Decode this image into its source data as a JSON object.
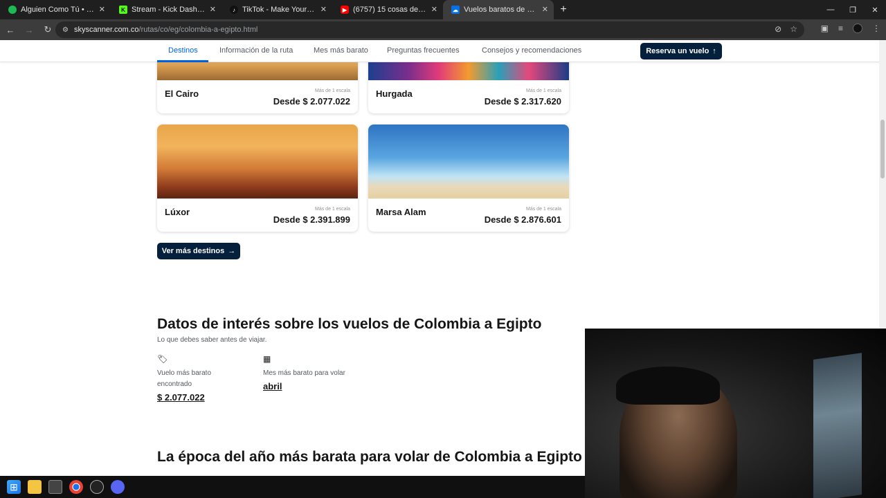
{
  "browser": {
    "tabs": [
      {
        "title": "Alguien Como Tú • Jósean Log",
        "favicon": "spotify-icon",
        "color": "#1db954",
        "active": false
      },
      {
        "title": "Stream - Kick Dashboard",
        "favicon": "kick-icon",
        "color": "#53fc18",
        "active": false
      },
      {
        "title": "TikTok - Make Your Day",
        "favicon": "tiktok-icon",
        "color": "#111111",
        "active": false
      },
      {
        "title": "(6757) 15 cosas de las pirámide",
        "favicon": "youtube-icon",
        "color": "#ff0000",
        "active": false
      },
      {
        "title": "Vuelos baratos de Colombia a E",
        "favicon": "skyscanner-icon",
        "color": "#0770e3",
        "active": true
      }
    ],
    "url_domain": "skyscanner.com.co",
    "url_path": "/rutas/co/eg/colombia-a-egipto.html"
  },
  "subnav": {
    "items": [
      "Destinos",
      "Información de la ruta",
      "Mes más barato",
      "Preguntas frecuentes",
      "Consejos y recomendaciones"
    ],
    "reserve_label": "Reserva un vuelo"
  },
  "destinations": [
    {
      "city": "El Cairo",
      "stops": "Más de 1 escala",
      "price": "Desde $ 2.077.022"
    },
    {
      "city": "Hurgada",
      "stops": "Más de 1 escala",
      "price": "Desde $ 2.317.620"
    },
    {
      "city": "Lúxor",
      "stops": "Más de 1 escala",
      "price": "Desde $ 2.391.899"
    },
    {
      "city": "Marsa Alam",
      "stops": "Más de 1 escala",
      "price": "Desde $ 2.876.601"
    }
  ],
  "more_destinations_label": "Ver más destinos",
  "facts": {
    "title": "Datos de interés sobre los vuelos de Colombia a Egipto",
    "subtitle": "Lo que debes saber antes de viajar.",
    "cheapest_flight_label": "Vuelo más barato encontrado",
    "cheapest_flight_value": "$ 2.077.022",
    "cheapest_month_label": "Mes más barato para volar",
    "cheapest_month_value": "abril"
  },
  "season_title": "La época del año más barata para volar de Colombia a Egipto",
  "colors": {
    "accent": "#0062e3",
    "button": "#05203c"
  }
}
